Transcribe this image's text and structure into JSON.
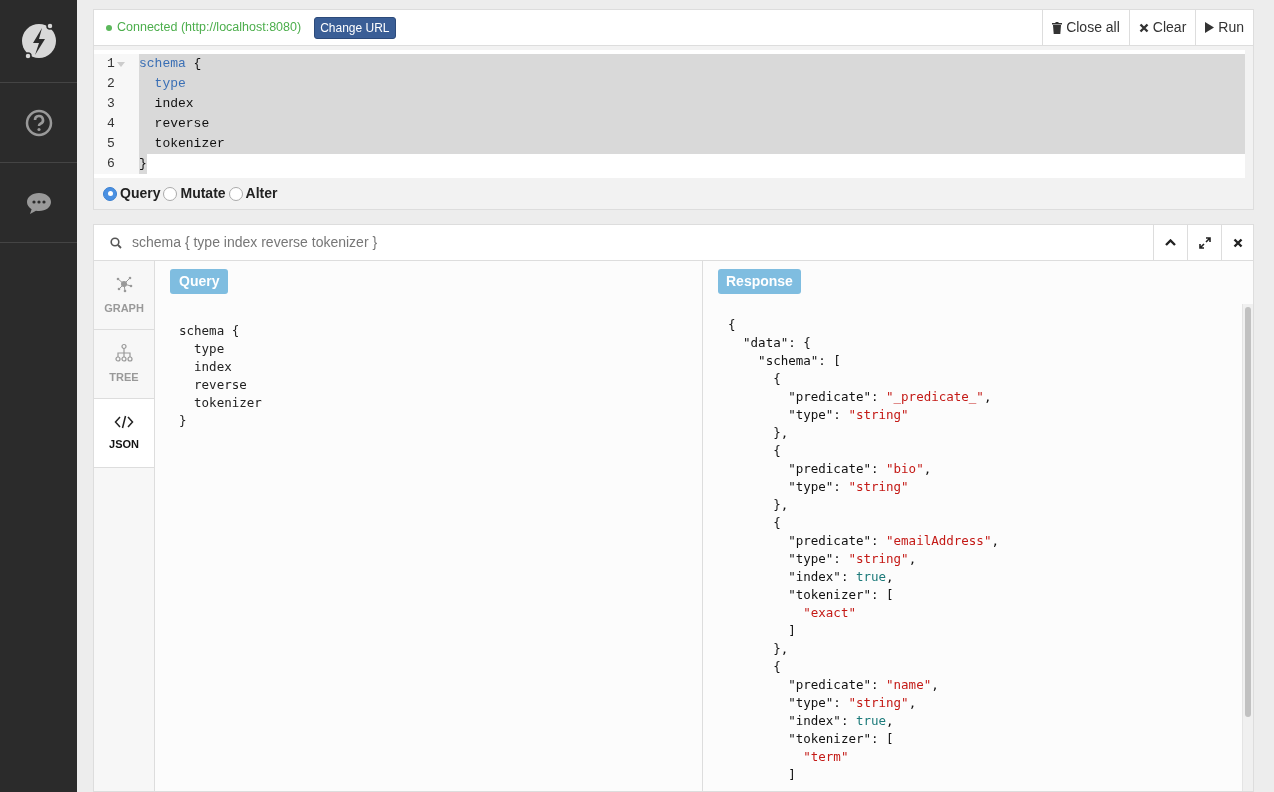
{
  "connection": {
    "status": "Connected (http://localhost:8080)",
    "connected": true,
    "button": "Change URL"
  },
  "toolbar": [
    {
      "kind": "trash",
      "label": "Close all"
    },
    {
      "kind": "close",
      "label": "Clear"
    },
    {
      "kind": "play",
      "label": "Run"
    }
  ],
  "editor": {
    "lines": [
      {
        "number": "1",
        "fold": true,
        "selected": true,
        "selected_to_end": true,
        "tokens": [
          {
            "kind": "keyword",
            "text": "schema"
          },
          {
            "kind": "plain",
            "text": " {"
          }
        ]
      },
      {
        "number": "2",
        "fold": false,
        "selected": true,
        "selected_to_end": true,
        "tokens": [
          {
            "kind": "keyword",
            "text": "  type"
          }
        ]
      },
      {
        "number": "3",
        "fold": false,
        "selected": true,
        "selected_to_end": true,
        "tokens": [
          {
            "kind": "plain",
            "text": "  index"
          }
        ]
      },
      {
        "number": "4",
        "fold": false,
        "selected": true,
        "selected_to_end": true,
        "tokens": [
          {
            "kind": "plain",
            "text": "  reverse"
          }
        ]
      },
      {
        "number": "5",
        "fold": false,
        "selected": true,
        "selected_to_end": true,
        "tokens": [
          {
            "kind": "plain",
            "text": "  tokenizer"
          }
        ]
      },
      {
        "number": "6",
        "fold": false,
        "selected": true,
        "selected_to_end": false,
        "tokens": [
          {
            "kind": "plain",
            "text": "}"
          }
        ]
      }
    ]
  },
  "modes": [
    {
      "label": "Query",
      "selected": true
    },
    {
      "label": "Mutate",
      "selected": false
    },
    {
      "label": "Alter",
      "selected": false
    }
  ],
  "result": {
    "title": "schema { type index reverse tokenizer }",
    "views": [
      {
        "kind": "graph",
        "label": "GRAPH",
        "selected": false
      },
      {
        "kind": "tree",
        "label": "TREE",
        "selected": false
      },
      {
        "kind": "json",
        "label": "JSON",
        "selected": true
      }
    ],
    "query_label": "Query",
    "query_lines": [
      "schema {",
      "  type",
      "  index",
      "  reverse",
      "  tokenizer",
      "}"
    ],
    "response_label": "Response",
    "response_lines": [
      [
        {
          "kind": "plain",
          "text": "{"
        }
      ],
      [
        {
          "kind": "plain",
          "text": "  \"data\": {"
        }
      ],
      [
        {
          "kind": "plain",
          "text": "    \"schema\": ["
        }
      ],
      [
        {
          "kind": "plain",
          "text": "      {"
        }
      ],
      [
        {
          "kind": "plain",
          "text": "        \"predicate\": "
        },
        {
          "kind": "string",
          "text": "\"_predicate_\""
        },
        {
          "kind": "plain",
          "text": ","
        }
      ],
      [
        {
          "kind": "plain",
          "text": "        \"type\": "
        },
        {
          "kind": "string",
          "text": "\"string\""
        }
      ],
      [
        {
          "kind": "plain",
          "text": "      },"
        }
      ],
      [
        {
          "kind": "plain",
          "text": "      {"
        }
      ],
      [
        {
          "kind": "plain",
          "text": "        \"predicate\": "
        },
        {
          "kind": "string",
          "text": "\"bio\""
        },
        {
          "kind": "plain",
          "text": ","
        }
      ],
      [
        {
          "kind": "plain",
          "text": "        \"type\": "
        },
        {
          "kind": "string",
          "text": "\"string\""
        }
      ],
      [
        {
          "kind": "plain",
          "text": "      },"
        }
      ],
      [
        {
          "kind": "plain",
          "text": "      {"
        }
      ],
      [
        {
          "kind": "plain",
          "text": "        \"predicate\": "
        },
        {
          "kind": "string",
          "text": "\"emailAddress\""
        },
        {
          "kind": "plain",
          "text": ","
        }
      ],
      [
        {
          "kind": "plain",
          "text": "        \"type\": "
        },
        {
          "kind": "string",
          "text": "\"string\""
        },
        {
          "kind": "plain",
          "text": ","
        }
      ],
      [
        {
          "kind": "plain",
          "text": "        \"index\": "
        },
        {
          "kind": "bool",
          "text": "true"
        },
        {
          "kind": "plain",
          "text": ","
        }
      ],
      [
        {
          "kind": "plain",
          "text": "        \"tokenizer\": ["
        }
      ],
      [
        {
          "kind": "string",
          "text": "          \"exact\""
        }
      ],
      [
        {
          "kind": "plain",
          "text": "        ]"
        }
      ],
      [
        {
          "kind": "plain",
          "text": "      },"
        }
      ],
      [
        {
          "kind": "plain",
          "text": "      {"
        }
      ],
      [
        {
          "kind": "plain",
          "text": "        \"predicate\": "
        },
        {
          "kind": "string",
          "text": "\"name\""
        },
        {
          "kind": "plain",
          "text": ","
        }
      ],
      [
        {
          "kind": "plain",
          "text": "        \"type\": "
        },
        {
          "kind": "string",
          "text": "\"string\""
        },
        {
          "kind": "plain",
          "text": ","
        }
      ],
      [
        {
          "kind": "plain",
          "text": "        \"index\": "
        },
        {
          "kind": "bool",
          "text": "true"
        },
        {
          "kind": "plain",
          "text": ","
        }
      ],
      [
        {
          "kind": "plain",
          "text": "        \"tokenizer\": ["
        }
      ],
      [
        {
          "kind": "string",
          "text": "          \"term\""
        }
      ],
      [
        {
          "kind": "plain",
          "text": "        ]"
        }
      ]
    ]
  }
}
